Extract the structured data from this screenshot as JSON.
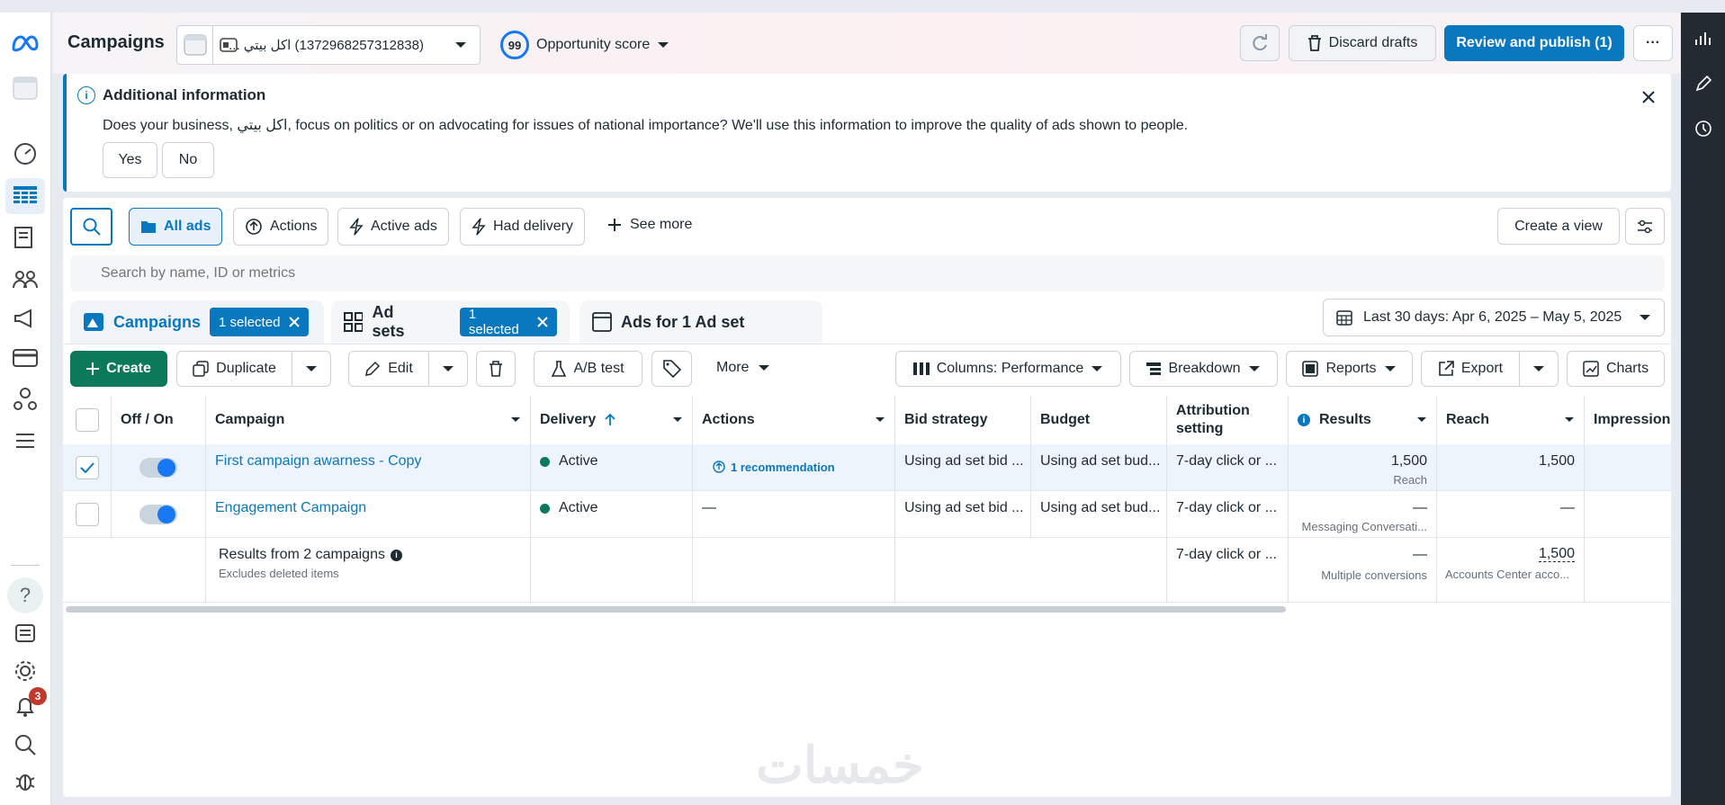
{
  "header": {
    "title": "Campaigns",
    "account": "(1372968257312838) اكل بيتي ...",
    "opportunity_score": "99",
    "opportunity_label": "Opportunity score",
    "discard_label": "Discard drafts",
    "publish_label": "Review and publish (1)"
  },
  "notice": {
    "title": "Additional information",
    "text": "Does your business, اكل بيتي, focus on politics or on advocating for issues of national importance? We'll use this information to improve the quality of ads shown to people.",
    "yes": "Yes",
    "no": "No"
  },
  "filters": {
    "all_ads": "All ads",
    "actions": "Actions",
    "active_ads": "Active ads",
    "had_delivery": "Had delivery",
    "see_more": "See more",
    "create_view": "Create a view",
    "search_placeholder": "Search by name, ID or metrics"
  },
  "tabs": {
    "campaigns": "Campaigns",
    "campaigns_badge": "1 selected",
    "adsets": "Ad sets",
    "adsets_badge": "1 selected",
    "ads": "Ads for 1 Ad set",
    "date_range": "Last 30 days: Apr 6, 2025 – May 5, 2025"
  },
  "toolbar": {
    "create": "Create",
    "duplicate": "Duplicate",
    "edit": "Edit",
    "ab_test": "A/B test",
    "more": "More",
    "columns": "Columns: Performance",
    "breakdown": "Breakdown",
    "reports": "Reports",
    "export": "Export",
    "charts": "Charts"
  },
  "table": {
    "headers": {
      "off_on": "Off / On",
      "campaign": "Campaign",
      "delivery": "Delivery",
      "actions": "Actions",
      "bid_strategy": "Bid strategy",
      "budget": "Budget",
      "attribution": "Attribution setting",
      "results": "Results",
      "reach": "Reach",
      "impressions": "Impressions"
    },
    "rows": [
      {
        "campaign": "First campaign awarness - Copy",
        "delivery": "Active",
        "actions": "1 recommendation",
        "bid_strategy": "Using ad set bid ...",
        "budget": "Using ad set bud...",
        "attribution": "7-day click or ...",
        "results": "1,500",
        "results_sub": "Reach",
        "reach": "1,500"
      },
      {
        "campaign": "Engagement Campaign",
        "delivery": "Active",
        "actions": "—",
        "bid_strategy": "Using ad set bid ...",
        "budget": "Using ad set bud...",
        "attribution": "7-day click or ...",
        "results": "—",
        "results_sub": "Messaging Conversati...",
        "reach": "—"
      }
    ],
    "summary": {
      "title": "Results from 2 campaigns",
      "sub": "Excludes deleted items",
      "attribution": "7-day click or ...",
      "results": "—",
      "results_sub": "Multiple conversions",
      "reach": "1,500",
      "reach_sub": "Accounts Center acco..."
    }
  },
  "sidebar": {
    "notification_count": "3"
  },
  "watermark": "خمسات",
  "colors": {
    "accent": "#0a78be",
    "create_green": "#0c7a5a",
    "toggle_on": "#1877f2",
    "active_dot": "#0c7a5a"
  }
}
